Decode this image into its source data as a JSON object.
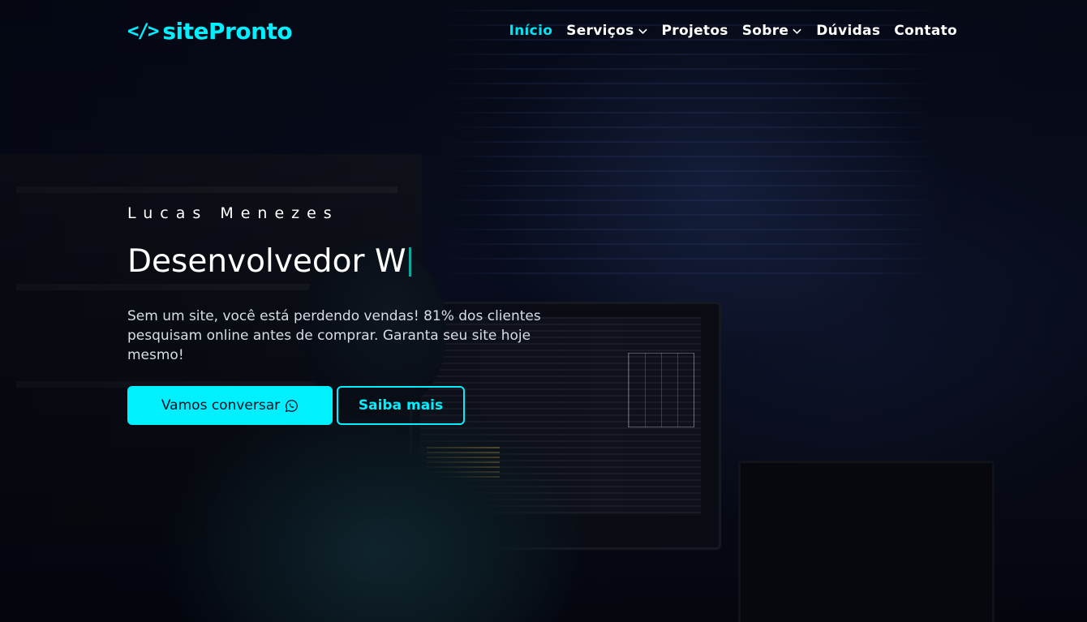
{
  "brand": {
    "logo_mark": "</>",
    "logo_text": "sitePronto",
    "accent_color": "#00f0ff"
  },
  "nav": {
    "items": [
      {
        "label": "Início",
        "active": true
      },
      {
        "label": "Serviços",
        "dropdown": true
      },
      {
        "label": "Projetos"
      },
      {
        "label": "Sobre",
        "dropdown": true
      },
      {
        "label": "Dúvidas"
      },
      {
        "label": "Contato"
      }
    ]
  },
  "hero": {
    "author": "Lucas Menezes",
    "headline": "Desenvolvedor W",
    "description": "Sem um site, você está perdendo vendas! 81% dos clientes pesquisam online antes de comprar. Garanta seu site hoje mesmo!",
    "primary_button": "Vamos conversar",
    "primary_button_icon": "whatsapp-icon",
    "secondary_button": "Saiba mais"
  }
}
